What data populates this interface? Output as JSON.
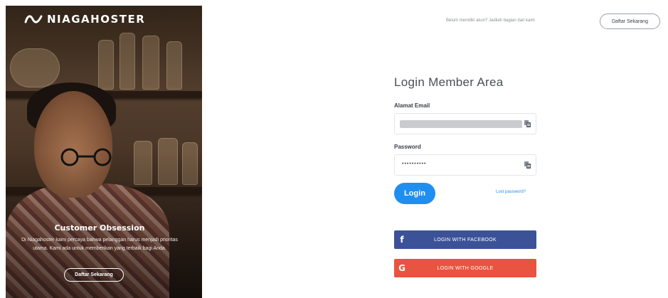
{
  "brand": {
    "name": "NIAGAHOSTER"
  },
  "hero": {
    "title": "Customer Obsession",
    "description": "Di Niagahoster kami percaya bahwa pelanggan harus menjadi prioritas utama. Kami ada untuk memberikan yang terbaik bagi Anda.",
    "button_label": "Daftar Sekarang"
  },
  "header": {
    "prompt": "Belum memiliki akun? Jadilah bagian dari kami",
    "signup_label": "Daftar Sekarang"
  },
  "form": {
    "title": "Login Member Area",
    "email_label": "Alamat Email",
    "password_label": "Password",
    "password_value": "••••••••••",
    "login_label": "Login",
    "lost_password_label": "Lost password?"
  },
  "social": {
    "facebook_label": "LOGIN WITH FACEBOOK",
    "google_label": "LOGIN WITH GOOGLE",
    "facebook_icon": "f",
    "google_icon": "G"
  },
  "colors": {
    "primary": "#1f8ef1",
    "facebook": "#3b5298",
    "google": "#e8543f"
  }
}
